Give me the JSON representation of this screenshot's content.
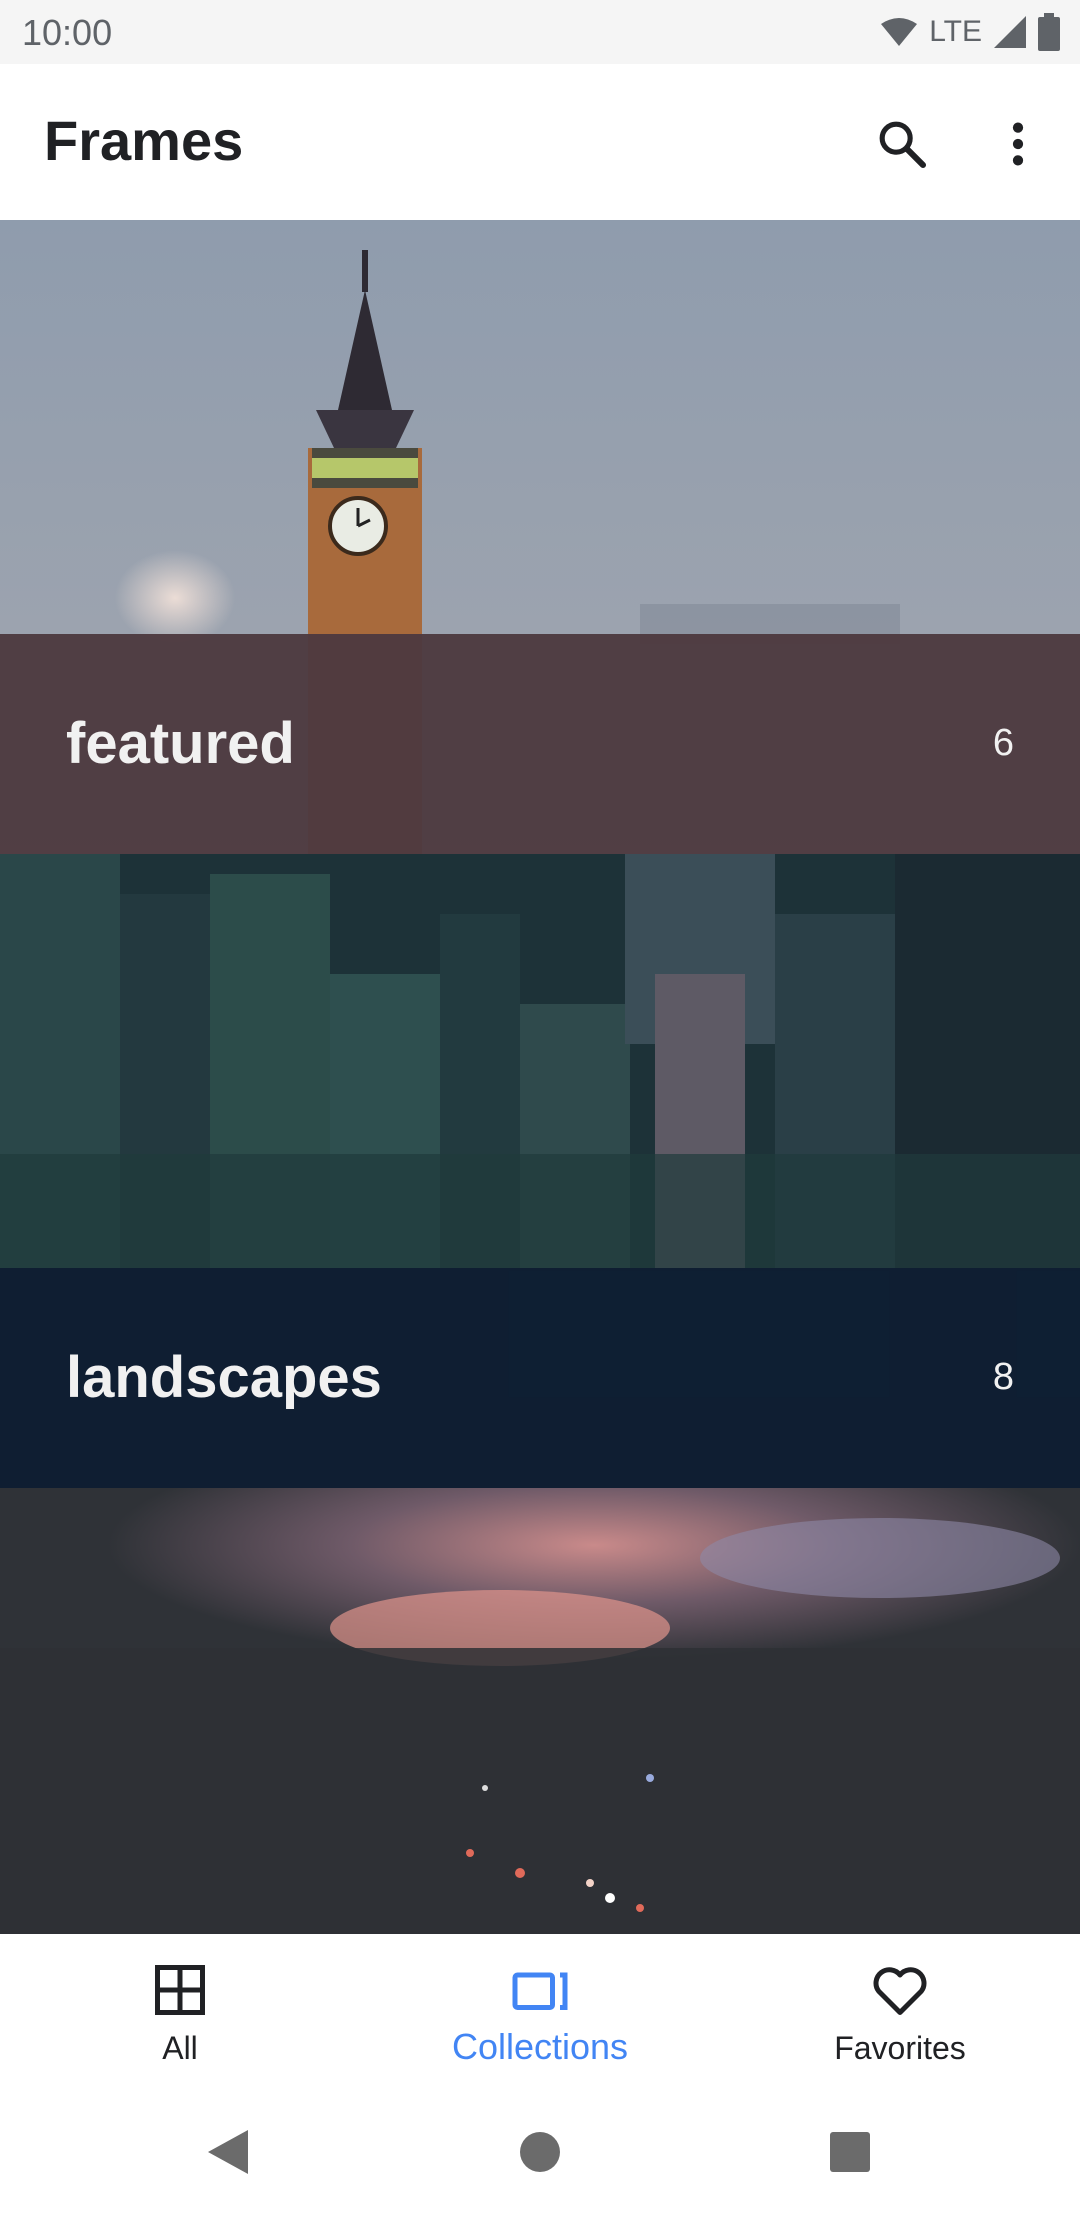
{
  "status_bar": {
    "time": "10:00",
    "network": "LTE",
    "icons": [
      "wifi-icon",
      "signal-icon",
      "battery-icon"
    ]
  },
  "app_bar": {
    "title": "Frames",
    "actions": [
      "search-icon",
      "more-vert-icon"
    ]
  },
  "collections": [
    {
      "title": "featured",
      "count": "6",
      "footer_color": "#4d393f"
    },
    {
      "title": "landscapes",
      "count": "8",
      "footer_color": "#0e1e33"
    },
    {
      "title": "",
      "count": "",
      "footer_color": "#2d2f33"
    }
  ],
  "bottom_nav": {
    "items": [
      {
        "label": "All",
        "icon": "grid-icon",
        "active": false
      },
      {
        "label": "Collections",
        "icon": "collections-icon",
        "active": true
      },
      {
        "label": "Favorites",
        "icon": "heart-icon",
        "active": false
      }
    ],
    "active_color": "#4285f4"
  },
  "system_nav": [
    "back-icon",
    "home-icon",
    "recents-icon"
  ]
}
